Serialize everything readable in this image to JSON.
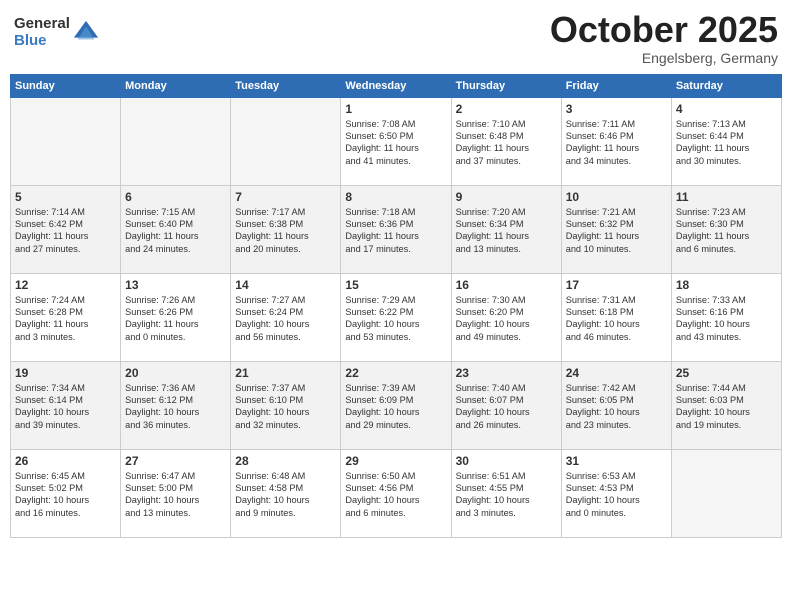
{
  "header": {
    "logo_general": "General",
    "logo_blue": "Blue",
    "month": "October 2025",
    "location": "Engelsberg, Germany"
  },
  "days_of_week": [
    "Sunday",
    "Monday",
    "Tuesday",
    "Wednesday",
    "Thursday",
    "Friday",
    "Saturday"
  ],
  "weeks": [
    [
      {
        "day": "",
        "info": ""
      },
      {
        "day": "",
        "info": ""
      },
      {
        "day": "",
        "info": ""
      },
      {
        "day": "1",
        "info": "Sunrise: 7:08 AM\nSunset: 6:50 PM\nDaylight: 11 hours\nand 41 minutes."
      },
      {
        "day": "2",
        "info": "Sunrise: 7:10 AM\nSunset: 6:48 PM\nDaylight: 11 hours\nand 37 minutes."
      },
      {
        "day": "3",
        "info": "Sunrise: 7:11 AM\nSunset: 6:46 PM\nDaylight: 11 hours\nand 34 minutes."
      },
      {
        "day": "4",
        "info": "Sunrise: 7:13 AM\nSunset: 6:44 PM\nDaylight: 11 hours\nand 30 minutes."
      }
    ],
    [
      {
        "day": "5",
        "info": "Sunrise: 7:14 AM\nSunset: 6:42 PM\nDaylight: 11 hours\nand 27 minutes."
      },
      {
        "day": "6",
        "info": "Sunrise: 7:15 AM\nSunset: 6:40 PM\nDaylight: 11 hours\nand 24 minutes."
      },
      {
        "day": "7",
        "info": "Sunrise: 7:17 AM\nSunset: 6:38 PM\nDaylight: 11 hours\nand 20 minutes."
      },
      {
        "day": "8",
        "info": "Sunrise: 7:18 AM\nSunset: 6:36 PM\nDaylight: 11 hours\nand 17 minutes."
      },
      {
        "day": "9",
        "info": "Sunrise: 7:20 AM\nSunset: 6:34 PM\nDaylight: 11 hours\nand 13 minutes."
      },
      {
        "day": "10",
        "info": "Sunrise: 7:21 AM\nSunset: 6:32 PM\nDaylight: 11 hours\nand 10 minutes."
      },
      {
        "day": "11",
        "info": "Sunrise: 7:23 AM\nSunset: 6:30 PM\nDaylight: 11 hours\nand 6 minutes."
      }
    ],
    [
      {
        "day": "12",
        "info": "Sunrise: 7:24 AM\nSunset: 6:28 PM\nDaylight: 11 hours\nand 3 minutes."
      },
      {
        "day": "13",
        "info": "Sunrise: 7:26 AM\nSunset: 6:26 PM\nDaylight: 11 hours\nand 0 minutes."
      },
      {
        "day": "14",
        "info": "Sunrise: 7:27 AM\nSunset: 6:24 PM\nDaylight: 10 hours\nand 56 minutes."
      },
      {
        "day": "15",
        "info": "Sunrise: 7:29 AM\nSunset: 6:22 PM\nDaylight: 10 hours\nand 53 minutes."
      },
      {
        "day": "16",
        "info": "Sunrise: 7:30 AM\nSunset: 6:20 PM\nDaylight: 10 hours\nand 49 minutes."
      },
      {
        "day": "17",
        "info": "Sunrise: 7:31 AM\nSunset: 6:18 PM\nDaylight: 10 hours\nand 46 minutes."
      },
      {
        "day": "18",
        "info": "Sunrise: 7:33 AM\nSunset: 6:16 PM\nDaylight: 10 hours\nand 43 minutes."
      }
    ],
    [
      {
        "day": "19",
        "info": "Sunrise: 7:34 AM\nSunset: 6:14 PM\nDaylight: 10 hours\nand 39 minutes."
      },
      {
        "day": "20",
        "info": "Sunrise: 7:36 AM\nSunset: 6:12 PM\nDaylight: 10 hours\nand 36 minutes."
      },
      {
        "day": "21",
        "info": "Sunrise: 7:37 AM\nSunset: 6:10 PM\nDaylight: 10 hours\nand 32 minutes."
      },
      {
        "day": "22",
        "info": "Sunrise: 7:39 AM\nSunset: 6:09 PM\nDaylight: 10 hours\nand 29 minutes."
      },
      {
        "day": "23",
        "info": "Sunrise: 7:40 AM\nSunset: 6:07 PM\nDaylight: 10 hours\nand 26 minutes."
      },
      {
        "day": "24",
        "info": "Sunrise: 7:42 AM\nSunset: 6:05 PM\nDaylight: 10 hours\nand 23 minutes."
      },
      {
        "day": "25",
        "info": "Sunrise: 7:44 AM\nSunset: 6:03 PM\nDaylight: 10 hours\nand 19 minutes."
      }
    ],
    [
      {
        "day": "26",
        "info": "Sunrise: 6:45 AM\nSunset: 5:02 PM\nDaylight: 10 hours\nand 16 minutes."
      },
      {
        "day": "27",
        "info": "Sunrise: 6:47 AM\nSunset: 5:00 PM\nDaylight: 10 hours\nand 13 minutes."
      },
      {
        "day": "28",
        "info": "Sunrise: 6:48 AM\nSunset: 4:58 PM\nDaylight: 10 hours\nand 9 minutes."
      },
      {
        "day": "29",
        "info": "Sunrise: 6:50 AM\nSunset: 4:56 PM\nDaylight: 10 hours\nand 6 minutes."
      },
      {
        "day": "30",
        "info": "Sunrise: 6:51 AM\nSunset: 4:55 PM\nDaylight: 10 hours\nand 3 minutes."
      },
      {
        "day": "31",
        "info": "Sunrise: 6:53 AM\nSunset: 4:53 PM\nDaylight: 10 hours\nand 0 minutes."
      },
      {
        "day": "",
        "info": ""
      }
    ]
  ]
}
